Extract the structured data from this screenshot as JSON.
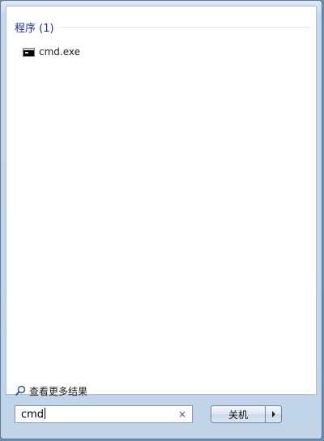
{
  "results": {
    "group_title": "程序 (1)",
    "items": [
      {
        "label": "cmd.exe",
        "icon": "console-icon"
      }
    ]
  },
  "see_more": {
    "label": "查看更多结果",
    "icon": "search-icon"
  },
  "search": {
    "value": "cmd",
    "clear_icon": "×"
  },
  "power": {
    "shutdown_label": "关机",
    "options_icon": "arrow-right-icon"
  }
}
